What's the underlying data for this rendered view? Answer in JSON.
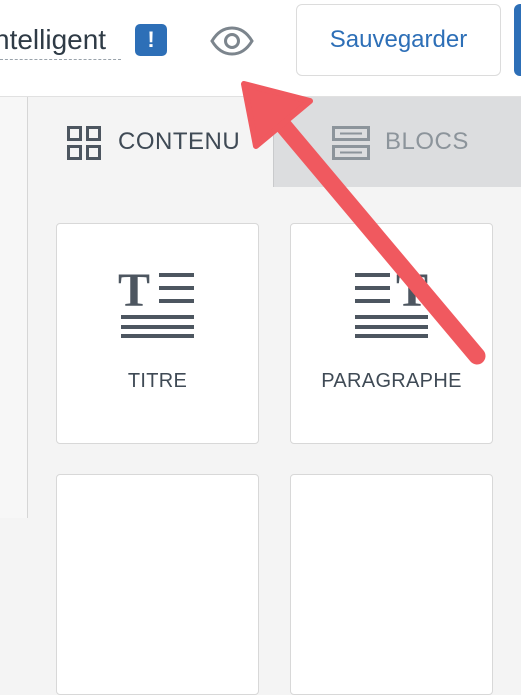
{
  "header": {
    "title": "ntelligent",
    "alert_badge": "!",
    "save_label": "Sauvegarder"
  },
  "icons": {
    "alert": "exclamation-badge-icon",
    "preview": "eye-icon",
    "content_tab": "grid-icon",
    "blocks_tab": "blocks-icon",
    "title_card": "title-text-icon",
    "paragraph_card": "paragraph-text-icon"
  },
  "tabs": [
    {
      "label": "CONTENU",
      "active": true
    },
    {
      "label": "BLOCS",
      "active": false
    }
  ],
  "cards": [
    {
      "label": "TITRE"
    },
    {
      "label": "PARAGRAPHE"
    },
    {
      "label": ""
    },
    {
      "label": ""
    }
  ],
  "annotation": {
    "type": "arrow",
    "color": "#f0595f",
    "target": "eye-icon"
  },
  "colors": {
    "accent": "#2d6fb7",
    "text": "#3f4a55",
    "muted_tab": "#8c949b",
    "arrow": "#f0595f"
  }
}
